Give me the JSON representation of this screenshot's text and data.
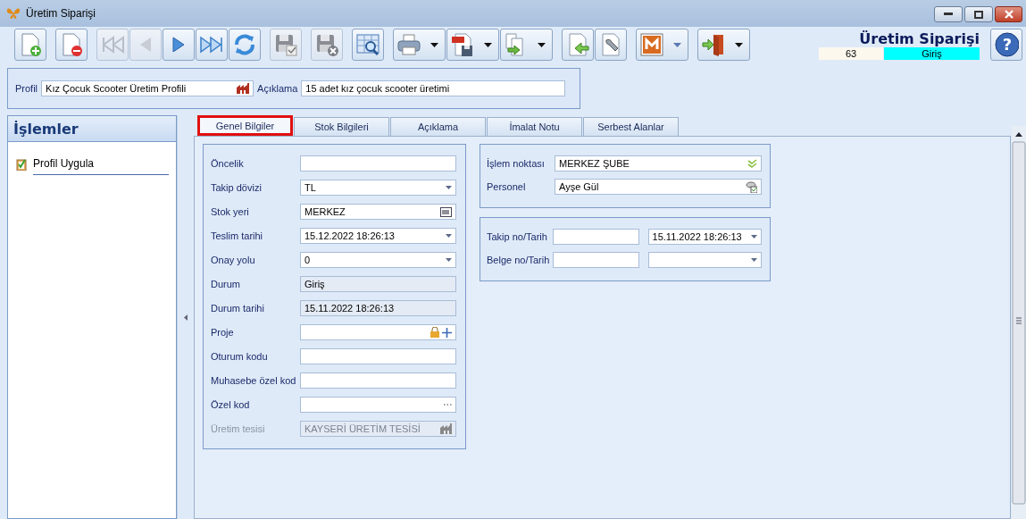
{
  "window": {
    "title": "Üretim Siparişi"
  },
  "toolbar": [
    [
      {
        "kind": "new",
        "disabled": false,
        "dropdown": false
      }
    ],
    [
      {
        "kind": "delete",
        "disabled": false,
        "dropdown": false
      }
    ],
    [
      {
        "kind": "first",
        "disabled": true,
        "dropdown": false
      },
      {
        "kind": "prev",
        "disabled": true,
        "dropdown": false
      },
      {
        "kind": "next",
        "disabled": false,
        "dropdown": false
      },
      {
        "kind": "last",
        "disabled": false,
        "dropdown": false
      },
      {
        "kind": "refresh",
        "disabled": false,
        "dropdown": false
      }
    ],
    [
      {
        "kind": "save",
        "disabled": true,
        "dropdown": false
      }
    ],
    [
      {
        "kind": "cancel",
        "disabled": true,
        "dropdown": false
      }
    ],
    [
      {
        "kind": "preview",
        "disabled": false,
        "dropdown": false
      }
    ],
    [
      {
        "kind": "print",
        "disabled": false,
        "dropdown": true
      },
      {
        "kind": "pdf",
        "disabled": false,
        "dropdown": true
      },
      {
        "kind": "export",
        "disabled": false,
        "dropdown": true
      }
    ],
    [
      {
        "kind": "import",
        "disabled": false,
        "dropdown": false
      },
      {
        "kind": "tools",
        "disabled": false,
        "dropdown": false
      }
    ],
    [
      {
        "kind": "m",
        "disabled": false,
        "dropdown": true
      }
    ],
    [
      {
        "kind": "exit",
        "disabled": false,
        "dropdown": true
      }
    ]
  ],
  "header": {
    "title": "Üretim Siparişi",
    "number": "63",
    "status": "Giriş",
    "help_symbol": "?"
  },
  "profile_bar": {
    "profile_label": "Profil",
    "profile_value": "Kız Çocuk Scooter Üretim Profili",
    "description_label": "Açıklama",
    "description_value": "15 adet kız çocuk scooter üretimi"
  },
  "side_panel": {
    "title": "İşlemler",
    "items": [
      {
        "label": "Profil Uygula"
      }
    ]
  },
  "tabs": [
    {
      "label": "Genel Bilgiler",
      "selected": true
    },
    {
      "label": "Stok Bilgileri",
      "selected": false
    },
    {
      "label": "Açıklama",
      "selected": false
    },
    {
      "label": "İmalat Notu",
      "selected": false
    },
    {
      "label": "Serbest Alanlar",
      "selected": false
    }
  ],
  "form_fields": [
    {
      "label": "Öncelik",
      "kind": "text",
      "disabled": false
    },
    {
      "label": "Takip dövizi",
      "value": "TL",
      "kind": "dropdown",
      "disabled": false
    },
    {
      "label": "Stok yeri",
      "value": "MERKEZ",
      "kind": "barcode",
      "disabled": false
    },
    {
      "label": "Teslim tarihi",
      "value": "15.12.2022 18:26:13",
      "kind": "dropdown",
      "disabled": false
    },
    {
      "label": "Onay yolu",
      "value": "0",
      "kind": "dropdown",
      "disabled": false
    },
    {
      "label": "Durum",
      "value": "Giriş",
      "kind": "readonly",
      "disabled": false
    },
    {
      "label": "Durum tarihi",
      "value": "15.11.2022 18:26:13",
      "kind": "readonly",
      "disabled": false
    },
    {
      "label": "Proje",
      "kind": "lock-add",
      "disabled": false
    },
    {
      "label": "Oturum kodu",
      "kind": "text",
      "disabled": false
    },
    {
      "label": "Muhasebe özel kod",
      "kind": "text",
      "disabled": false
    },
    {
      "label": "Özel kod",
      "kind": "ellipsis",
      "disabled": false
    },
    {
      "label": "Üretim tesisi",
      "value": "KAYSERİ ÜRETİM TESİSİ",
      "kind": "factory",
      "disabled": true
    }
  ],
  "right_groups": [
    {
      "rows": [
        {
          "label": "İşlem noktası",
          "inputs": [
            {
              "value": "MERKEZ ŞUBE",
              "kind": "check"
            }
          ]
        },
        {
          "label": "Personel",
          "inputs": [
            {
              "value": "Ayşe Gül",
              "kind": "user"
            }
          ]
        }
      ]
    },
    {
      "rows": [
        {
          "label": "Takip no/Tarih",
          "inputs": [
            {
              "kind": "text"
            },
            {
              "value": "15.11.2022 18:26:13",
              "kind": "dropdown"
            }
          ]
        },
        {
          "label": "Belge no/Tarih",
          "inputs": [
            {
              "kind": "text"
            },
            {
              "kind": "dropdown"
            }
          ]
        }
      ]
    }
  ]
}
